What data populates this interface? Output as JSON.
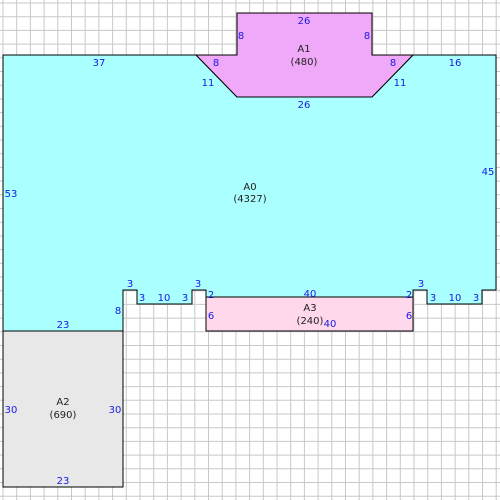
{
  "colors": {
    "grid": "#c8c8c8",
    "outline": "#000000",
    "dimension_text": "#1a1ae6",
    "label_text": "#222222"
  },
  "areas": [
    {
      "id": "A0",
      "name": "A0",
      "area": "(4327)",
      "fill": "#aaffff"
    },
    {
      "id": "A1",
      "name": "A1",
      "area": "(480)",
      "fill": "#f0a8f8"
    },
    {
      "id": "A2",
      "name": "A2",
      "area": "(690)",
      "fill": "#e8e8e8"
    },
    {
      "id": "A3",
      "name": "A3",
      "area": "(240)",
      "fill": "#ffd8ec"
    }
  ],
  "dimensions": [
    "26",
    "8",
    "8",
    "8",
    "8",
    "11",
    "11",
    "26",
    "37",
    "16",
    "53",
    "45",
    "3",
    "3",
    "10",
    "3",
    "3",
    "2",
    "40",
    "2",
    "3",
    "3",
    "10",
    "3",
    "8",
    "6",
    "40",
    "6",
    "23",
    "30",
    "30",
    "23"
  ]
}
